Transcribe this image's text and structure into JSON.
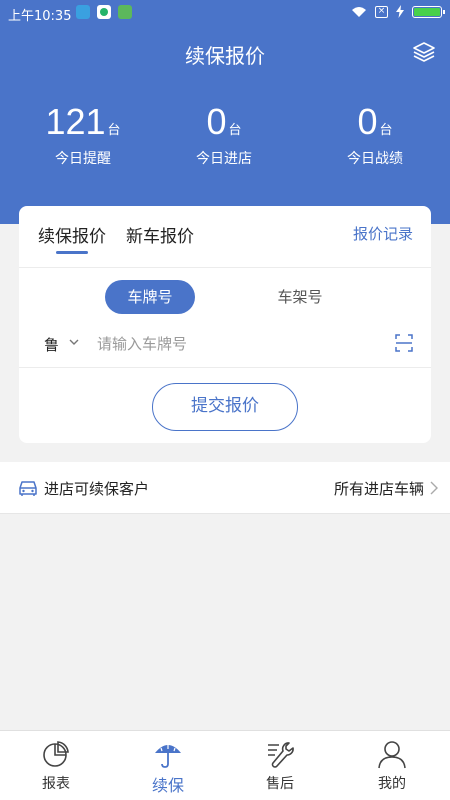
{
  "status_bar": {
    "time": "上午10:35"
  },
  "header": {
    "title": "续保报价",
    "layers_icon": "layers-icon"
  },
  "stats": [
    {
      "value": "121",
      "unit": "台",
      "label": "今日提醒"
    },
    {
      "value": "0",
      "unit": "台",
      "label": "今日进店"
    },
    {
      "value": "0",
      "unit": "台",
      "label": "今日战绩"
    }
  ],
  "card": {
    "tabs": [
      {
        "label": "续保报价",
        "active": true
      },
      {
        "label": "新车报价",
        "active": false
      }
    ],
    "record_link": "报价记录",
    "modes": {
      "active": "车牌号",
      "inactive": "车架号"
    },
    "province": "鲁",
    "plate_input": {
      "value": "",
      "placeholder": "请输入车牌号"
    },
    "submit_label": "提交报价"
  },
  "customers": {
    "title": "进店可续保客户",
    "link": "所有进店车辆"
  },
  "bottom_nav": [
    {
      "label": "报表",
      "icon": "pie-chart-icon",
      "active": false
    },
    {
      "label": "续保",
      "icon": "umbrella-icon",
      "active": true
    },
    {
      "label": "售后",
      "icon": "wrench-icon",
      "active": false
    },
    {
      "label": "我的",
      "icon": "person-icon",
      "active": false
    }
  ],
  "colors": {
    "primary": "#4a74c9",
    "background": "#f2f2f2"
  }
}
